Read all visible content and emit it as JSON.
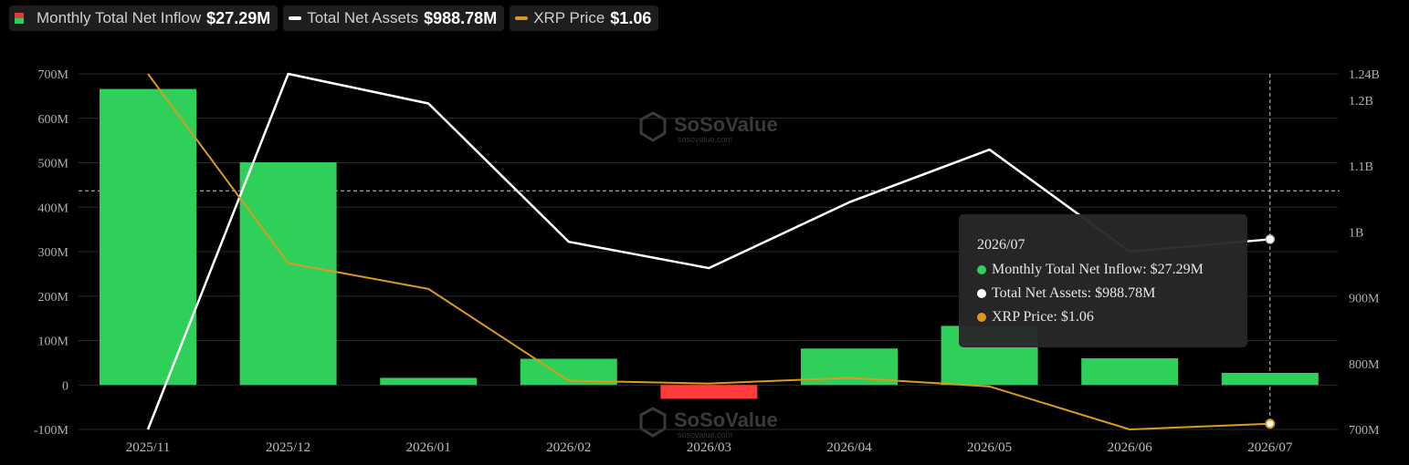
{
  "legend": {
    "inflow_label": "Monthly Total Net Inflow",
    "inflow_value": "$27.29M",
    "assets_label": "Total Net Assets",
    "assets_value": "$988.78M",
    "price_label": "XRP Price",
    "price_value": "$1.06"
  },
  "watermark": {
    "brand": "SoSoValue",
    "domain": "sosovalue.com"
  },
  "tooltip": {
    "title": "2026/07",
    "inflow": "Monthly Total Net Inflow: $27.29M",
    "assets": "Total Net Assets: $988.78M",
    "price": "XRP Price: $1.06"
  },
  "colors": {
    "positive_bar": "#2fd05a",
    "negative_bar": "#ff3b3b",
    "assets_line": "#ffffff",
    "price_line": "#d99a22",
    "background": "#000000"
  },
  "chart_data": {
    "type": "bar",
    "categories": [
      "2025/11",
      "2025/12",
      "2026/01",
      "2026/02",
      "2026/03",
      "2026/04",
      "2026/05",
      "2026/06",
      "2026/07"
    ],
    "left_axis": {
      "ticks": [
        "-100M",
        "0",
        "100M",
        "200M",
        "300M",
        "400M",
        "500M",
        "600M",
        "700M"
      ],
      "range": [
        -100,
        700
      ],
      "unit": "M"
    },
    "right_axis": {
      "ticks": [
        "700M",
        "800M",
        "900M",
        "1B",
        "1.1B",
        "1.2B",
        "1.24B"
      ],
      "range": [
        700,
        1240
      ],
      "unit": "M"
    },
    "grid": true,
    "series": [
      {
        "name": "Monthly Total Net Inflow",
        "type": "bar",
        "axis": "left",
        "values": [
          666,
          501,
          16,
          59,
          -31,
          82,
          133,
          60,
          27.29
        ]
      },
      {
        "name": "Total Net Assets",
        "type": "line",
        "axis": "right",
        "values": [
          700,
          1240,
          1195,
          985,
          945,
          1045,
          1125,
          970,
          988.78
        ]
      },
      {
        "name": "XRP Price",
        "type": "line",
        "axis": "hidden",
        "values": [
          2.28,
          1.62,
          1.53,
          1.21,
          1.2,
          1.22,
          1.19,
          1.04,
          1.06
        ]
      }
    ],
    "reference_line": {
      "axis": "left",
      "value": 437
    },
    "highlight": {
      "category": "2026/07"
    }
  }
}
